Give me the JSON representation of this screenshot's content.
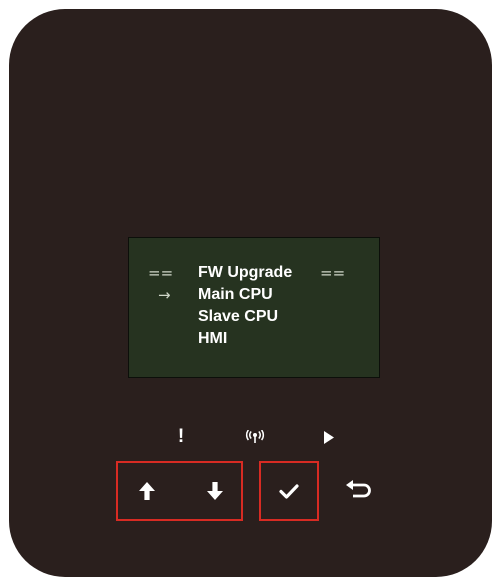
{
  "screen": {
    "title": "FW Upgrade",
    "title_left_deco": "==",
    "title_right_deco": "==",
    "cursor_glyph": "→",
    "menu_items": [
      {
        "label": "Main CPU"
      },
      {
        "label": "Slave CPU"
      },
      {
        "label": "HMI"
      }
    ],
    "selected_index": 0
  },
  "indicators": {
    "alarm": {
      "icon": "exclamation-icon",
      "glyph": "!"
    },
    "communication": {
      "icon": "wireless-signal-icon",
      "glyph": "(ᵒ)"
    },
    "run": {
      "icon": "play-icon",
      "glyph": "▶"
    }
  },
  "buttons": {
    "up": {
      "icon": "arrow-up-icon"
    },
    "down": {
      "icon": "arrow-down-icon"
    },
    "enter": {
      "icon": "checkmark-icon"
    },
    "back": {
      "icon": "return-arrow-icon"
    }
  },
  "colors": {
    "panel": "#2a1f1d",
    "screen": "#263320",
    "highlight_border": "#d82b23",
    "text": "#ffffff"
  }
}
